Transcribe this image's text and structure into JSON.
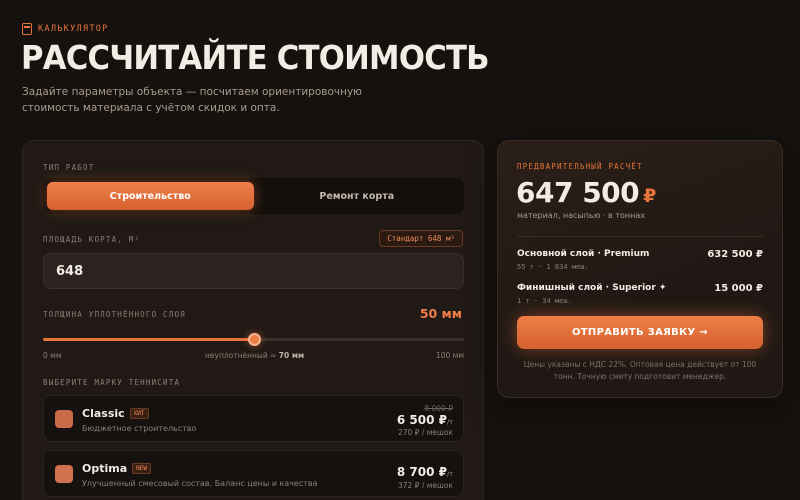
{
  "header": {
    "eyebrow": "КАЛЬКУЛЯТОР",
    "title": "РАССЧИТАЙТЕ СТОИМОСТЬ",
    "subtitle": "Задайте параметры объекта — посчитаем ориентировочную стоимость материала с учётом скидок и опта."
  },
  "form": {
    "work_type_label": "ТИП РАБОТ",
    "work_types": [
      {
        "label": "Строительство",
        "active": true
      },
      {
        "label": "Ремонт корта",
        "active": false
      }
    ],
    "area_label": "ПЛОЩАДЬ КОРТА, М²",
    "area_badge": "Стандарт 648 м²",
    "area_value": "648",
    "thickness_label": "ТОЛЩИНА УПЛОТНЁННОГО СЛОЯ",
    "thickness_value": "50 мм",
    "slider": {
      "value": 50,
      "min": 0,
      "max": 100,
      "min_label": "0 мм",
      "max_label": "100 мм",
      "mid_label_prefix": "неуплотнённый ≈ ",
      "mid_label_value": "70 мм"
    },
    "brand_label": "ВЫБЕРИТЕ МАРКУ ТЕННИСИТА",
    "brands": [
      {
        "name": "Classic",
        "tag": "ХИТ",
        "desc": "Бюджетное строительство",
        "old_price": "8 000 ₽",
        "price": "6 500 ₽",
        "unit": "/т",
        "bag": "270 ₽ / мешок",
        "color": "#c96a48"
      },
      {
        "name": "Optima",
        "tag": "NEW",
        "desc": "Улучшенный смесовый состав. Баланс цены и качества",
        "old_price": "",
        "price": "8 700 ₽",
        "unit": "/т",
        "bag": "372 ₽ / мешок",
        "color": "#d0704c"
      }
    ]
  },
  "summary": {
    "eyebrow": "ПРЕДВАРИТЕЛЬНЫЙ РАСЧЁТ",
    "total": "647 500",
    "currency": "₽",
    "note": "материал, насыпью · в тоннах",
    "rows": [
      {
        "title": "Основной слой · Premium",
        "sub": "55 т · 1 834 меш.",
        "value": "632 500 ₽"
      },
      {
        "title": "Финишный слой · Superior ✦",
        "sub": "1 т · 34 меш.",
        "value": "15 000 ₽"
      }
    ],
    "cta": "ОТПРАВИТЬ ЗАЯВКУ →",
    "footnote": "Цены указаны с НДС 22%. Оптовая цена действует от 100 тонн. Точную смету подготовит менеджер."
  },
  "colors": {
    "accent": "#e8743b",
    "background": "#15110e",
    "card": "#201915"
  }
}
